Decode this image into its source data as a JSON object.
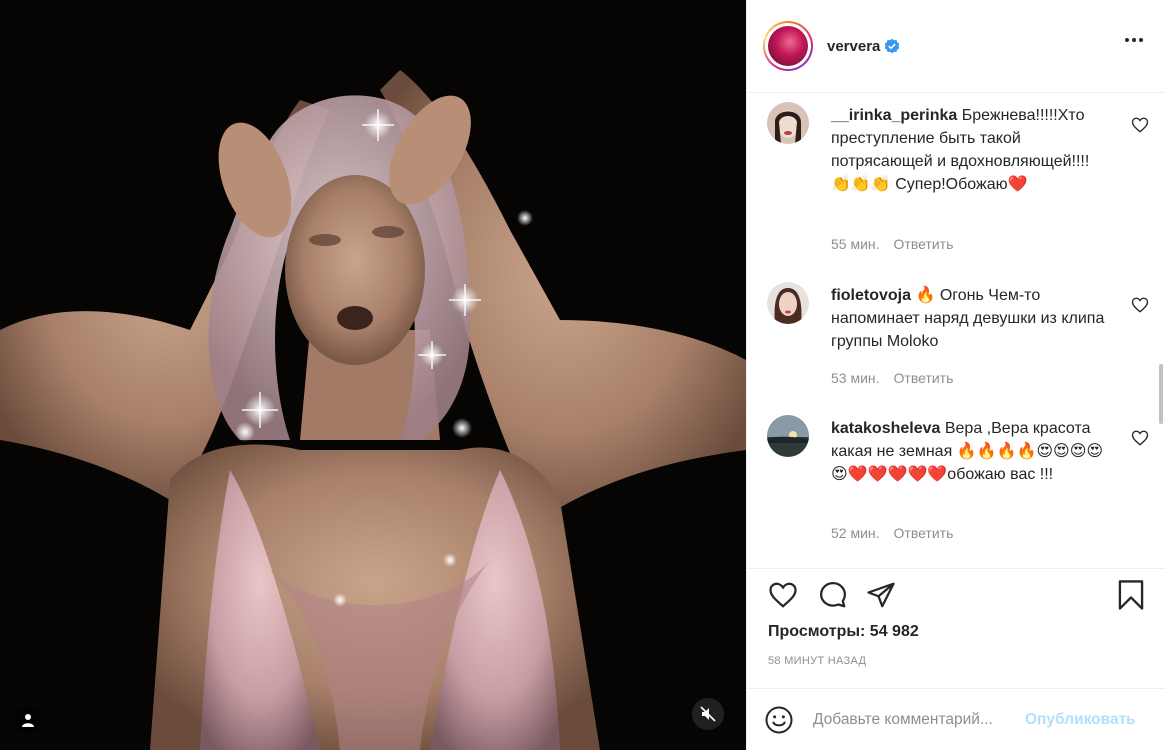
{
  "post": {
    "username": "ververa",
    "verified": true,
    "views_label": "Просмотры:",
    "views_value": "54 982",
    "time_ago": "58 минут назад"
  },
  "comments": [
    {
      "username": "__irinka_perinka",
      "text": "Брежнева!!!!!Хто преступление быть такой потрясающей и вдохновляющей!!!!👏👏👏 Супер!Обожаю❤️",
      "time": "55 мин.",
      "reply": "Ответить"
    },
    {
      "username": "fioletovoja",
      "text": "🔥 Огонь Чем-то напоминает наряд девушки из клипа группы Moloko",
      "time": "53 мин.",
      "reply": "Ответить"
    },
    {
      "username": "katakosheleva",
      "text": "Вера ,Вера красота какая не земная 🔥🔥🔥🔥😍😍😍😍😍❤️❤️❤️❤️❤️обожаю вас !!!",
      "time": "52 мин.",
      "reply": "Ответить"
    }
  ],
  "add_comment": {
    "placeholder": "Добавьте комментарий...",
    "publish": "Опубликовать"
  },
  "colors": {
    "accent": "#0095f6",
    "publish_disabled": "#b2dffc",
    "heart": "#e0245e",
    "muted_text": "#8e8e8e"
  },
  "icons": [
    "user-tag-icon",
    "mute-icon",
    "verified-icon",
    "more-icon",
    "like-icon",
    "comment-icon",
    "share-icon",
    "save-icon",
    "emoji-icon"
  ]
}
